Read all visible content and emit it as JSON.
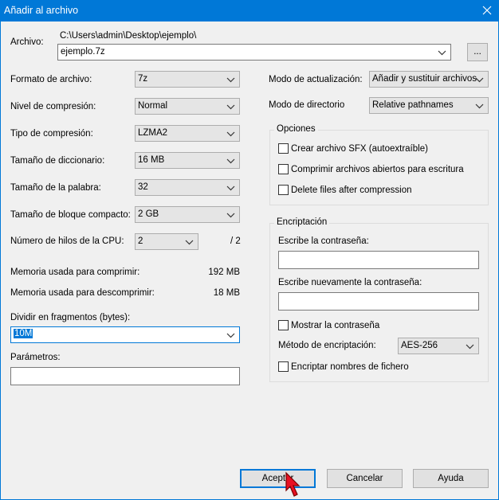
{
  "window": {
    "title": "Añadir al archivo"
  },
  "archive": {
    "label": "Archivo:",
    "path": "C:\\Users\\admin\\Desktop\\ejemplo\\",
    "filename": "ejemplo.7z",
    "browse_label": "..."
  },
  "left": {
    "format_label": "Formato de archivo:",
    "format_value": "7z",
    "level_label": "Nivel de compresión:",
    "level_value": "Normal",
    "type_label": "Tipo de compresión:",
    "type_value": "LZMA2",
    "dict_label": "Tamaño de diccionario:",
    "dict_value": "16 MB",
    "word_label": "Tamaño de la palabra:",
    "word_value": "32",
    "block_label": "Tamaño de bloque compacto:",
    "block_value": "2 GB",
    "threads_label": "Número de hilos de la CPU:",
    "threads_value": "2",
    "threads_total": "/ 2",
    "mem_compress_label": "Memoria usada para comprimir:",
    "mem_compress_value": "192 MB",
    "mem_decompress_label": "Memoria usada para descomprimir:",
    "mem_decompress_value": "18 MB",
    "split_label": "Dividir en fragmentos (bytes):",
    "split_value": "10M",
    "params_label": "Parámetros:",
    "params_value": ""
  },
  "right": {
    "update_label": "Modo de actualización:",
    "update_value": "Añadir y sustituir archivos",
    "pathmode_label": "Modo de directorio",
    "pathmode_value": "Relative pathnames",
    "options": {
      "title": "Opciones",
      "sfx_label": "Crear archivo SFX (autoextraíble)",
      "shared_label": "Comprimir archivos abiertos para escritura",
      "delete_label": "Delete files after compression"
    },
    "encryption": {
      "title": "Encriptación",
      "password_label": "Escribe la contraseña:",
      "password_value": "",
      "repeat_label": "Escribe nuevamente la contraseña:",
      "repeat_value": "",
      "show_label": "Mostrar la contraseña",
      "method_label": "Método de encriptación:",
      "method_value": "AES-256",
      "encrypt_names_label": "Encriptar nombres de fichero"
    }
  },
  "buttons": {
    "ok": "Aceptar",
    "cancel": "Cancelar",
    "help": "Ayuda"
  },
  "icons": {
    "close": "close-icon",
    "dropdown": "chevron-down-icon",
    "cursor": "mouse-pointer-icon"
  },
  "colors": {
    "titlebar": "#0078d7",
    "background": "#f0f0f0",
    "cursor": "#e81123"
  }
}
